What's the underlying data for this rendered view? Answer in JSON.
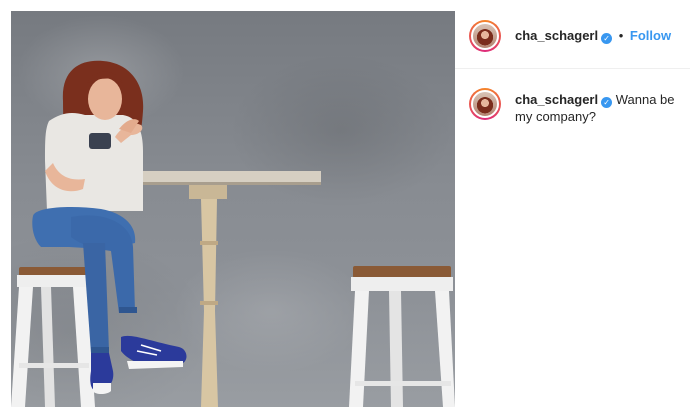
{
  "post": {
    "author": {
      "username": "cha_schagerl",
      "verified": true
    },
    "header": {
      "separator": "•",
      "follow_label": "Follow"
    },
    "caption": {
      "username": "cha_schagerl",
      "text": "Wanna be my company?"
    },
    "photo": {
      "description_icon": "post-photo"
    }
  },
  "colors": {
    "accent": "#3897f0",
    "text": "#262626",
    "divider": "#efefef"
  }
}
